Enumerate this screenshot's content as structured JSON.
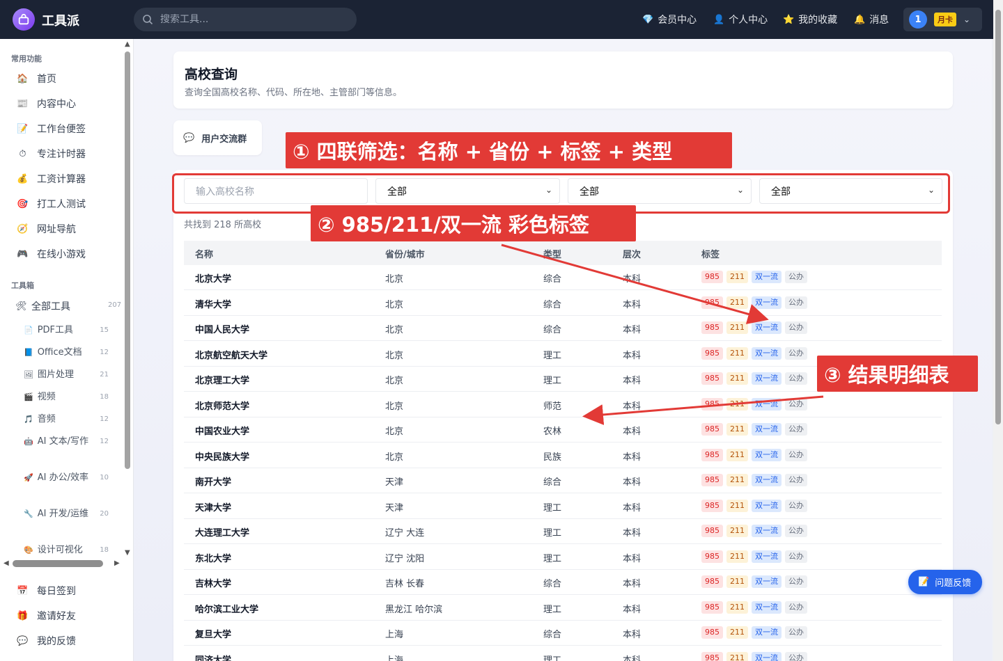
{
  "header": {
    "brand": "工具派",
    "search_placeholder": "搜索工具...",
    "nav": [
      {
        "label": "会员中心",
        "icon": "💎"
      },
      {
        "label": "个人中心",
        "icon": "👤"
      },
      {
        "label": "我的收藏",
        "icon": "⭐"
      },
      {
        "label": "消息",
        "icon": "🔔"
      }
    ],
    "avatar_text": "1",
    "card_badge": "月卡",
    "chevron": "⌄"
  },
  "sidebar": {
    "common_title": "常用功能",
    "common_items": [
      {
        "label": "首页",
        "icon": "🏠"
      },
      {
        "label": "内容中心",
        "icon": "📰"
      },
      {
        "label": "工作台便签",
        "icon": "📝"
      },
      {
        "label": "专注计时器",
        "icon": "⏱"
      },
      {
        "label": "工资计算器",
        "icon": "💰"
      },
      {
        "label": "打工人测试",
        "icon": "🎯"
      },
      {
        "label": "网址导航",
        "icon": "🧭"
      },
      {
        "label": "在线小游戏",
        "icon": "🎮"
      }
    ],
    "toolbox_title": "工具箱",
    "all_tools": {
      "label": "全部工具",
      "count": "207",
      "icon": "🛠"
    },
    "sub_items": [
      {
        "label": "PDF工具",
        "count": "15",
        "icon": "📄"
      },
      {
        "label": "Office文档",
        "count": "12",
        "icon": "📘"
      },
      {
        "label": "图片处理",
        "count": "21",
        "icon": "🖼"
      },
      {
        "label": "视频",
        "count": "18",
        "icon": "🎬"
      },
      {
        "label": "音频",
        "count": "12",
        "icon": "🎵"
      },
      {
        "label": "AI 文本/写作",
        "count": "12",
        "icon": "🤖"
      },
      {
        "label": "AI 办公/效率",
        "count": "10",
        "icon": "🚀"
      },
      {
        "label": "AI 开发/运维",
        "count": "20",
        "icon": "🔧"
      },
      {
        "label": "设计可视化",
        "count": "18",
        "icon": "🎨"
      }
    ],
    "bottom_items": [
      {
        "label": "每日签到",
        "icon": "📅"
      },
      {
        "label": "邀请好友",
        "icon": "🎁"
      },
      {
        "label": "我的反馈",
        "icon": "💬"
      }
    ]
  },
  "page": {
    "title": "高校查询",
    "description": "查询全国高校名称、代码、所在地、主管部门等信息。",
    "group_button": "用户交流群",
    "group_icon": "💬",
    "filters": {
      "name_placeholder": "输入高校名称",
      "province": "全部",
      "tag": "全部",
      "type": "全部"
    },
    "result_count": "共找到 218 所高校",
    "columns": [
      "名称",
      "省份/城市",
      "类型",
      "层次",
      "标签"
    ],
    "rows": [
      {
        "name": "北京大学",
        "city": "北京",
        "type": "综合",
        "level": "本科"
      },
      {
        "name": "清华大学",
        "city": "北京",
        "type": "综合",
        "level": "本科"
      },
      {
        "name": "中国人民大学",
        "city": "北京",
        "type": "综合",
        "level": "本科"
      },
      {
        "name": "北京航空航天大学",
        "city": "北京",
        "type": "理工",
        "level": "本科"
      },
      {
        "name": "北京理工大学",
        "city": "北京",
        "type": "理工",
        "level": "本科"
      },
      {
        "name": "北京师范大学",
        "city": "北京",
        "type": "师范",
        "level": "本科"
      },
      {
        "name": "中国农业大学",
        "city": "北京",
        "type": "农林",
        "level": "本科"
      },
      {
        "name": "中央民族大学",
        "city": "北京",
        "type": "民族",
        "level": "本科"
      },
      {
        "name": "南开大学",
        "city": "天津",
        "type": "综合",
        "level": "本科"
      },
      {
        "name": "天津大学",
        "city": "天津",
        "type": "理工",
        "level": "本科"
      },
      {
        "name": "大连理工大学",
        "city": "辽宁 大连",
        "type": "理工",
        "level": "本科"
      },
      {
        "name": "东北大学",
        "city": "辽宁 沈阳",
        "type": "理工",
        "level": "本科"
      },
      {
        "name": "吉林大学",
        "city": "吉林 长春",
        "type": "综合",
        "level": "本科"
      },
      {
        "name": "哈尔滨工业大学",
        "city": "黑龙江 哈尔滨",
        "type": "理工",
        "level": "本科"
      },
      {
        "name": "复旦大学",
        "city": "上海",
        "type": "综合",
        "level": "本科"
      },
      {
        "name": "同济大学",
        "city": "上海",
        "type": "理工",
        "level": "本科"
      }
    ],
    "tags": [
      "985",
      "211",
      "双一流",
      "公办"
    ]
  },
  "annotations": {
    "a1": "① 四联筛选：名称 + 省份 + 标签 + 类型",
    "a2": "② 985/211/双一流 彩色标签",
    "a3": "③ 结果明细表",
    "color": "#e23a36"
  },
  "feedback_button": "问题反馈",
  "feedback_icon": "📝"
}
